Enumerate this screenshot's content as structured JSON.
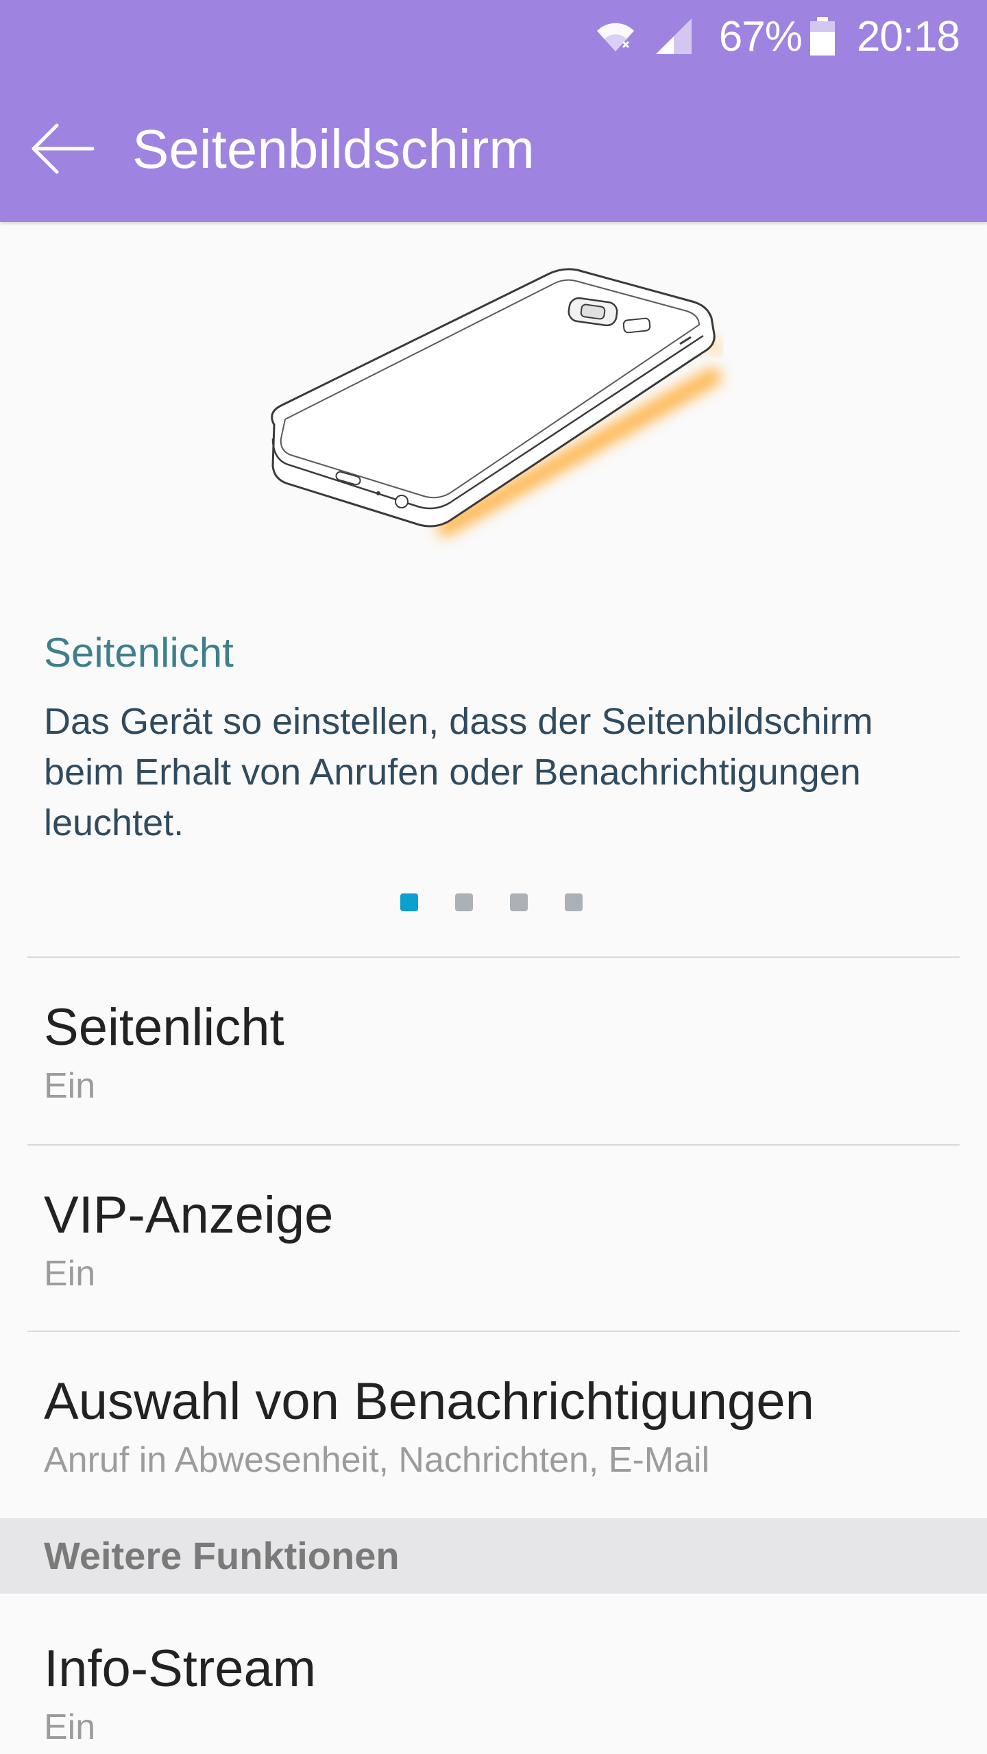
{
  "status_bar": {
    "battery_percent": "67%",
    "time": "20:18",
    "icons": [
      "wifi-icon",
      "signal-icon",
      "battery-icon"
    ]
  },
  "app_bar": {
    "title": "Seitenbildschirm",
    "back_icon": "arrow-left-icon"
  },
  "tip": {
    "title": "Seitenlicht",
    "text": "Das Gerät so einstellen, dass der Seitenbildschirm beim Erhalt von Anrufen oder Benachrichtigungen leuchtet.",
    "page_count": 4,
    "active_page": 1
  },
  "settings": [
    {
      "title": "Seitenlicht",
      "subtitle": "Ein"
    },
    {
      "title": "VIP-Anzeige",
      "subtitle": "Ein"
    },
    {
      "title": "Auswahl von Benachrichtigungen",
      "subtitle": "Anruf in Abwesenheit, Nachrichten, E-Mail"
    }
  ],
  "more_section": {
    "header": "Weitere Funktionen",
    "items": [
      {
        "title": "Info-Stream",
        "subtitle": "Ein"
      }
    ]
  },
  "colors": {
    "header_bg": "#9e84e0",
    "accent_title": "#3e7f89",
    "active_dot": "#0d9fd0",
    "edge_glow": "#ffb347"
  }
}
